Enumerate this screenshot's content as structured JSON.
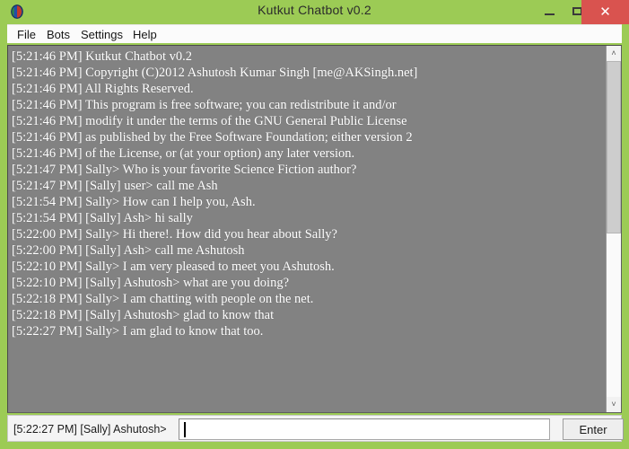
{
  "window": {
    "title": "Kutkut Chatbot v0.2",
    "icon": "globe-icon",
    "titlebar_color": "#9ccb55",
    "close_button_color": "#d9534f",
    "controls": {
      "minimize_label": "–",
      "maximize_label": "□",
      "close_label": "✕"
    }
  },
  "menubar": {
    "items": [
      {
        "label": "File"
      },
      {
        "label": "Bots"
      },
      {
        "label": "Settings"
      },
      {
        "label": "Help"
      }
    ]
  },
  "chatlog": {
    "background_color": "#828282",
    "text_color": "#ffffff",
    "lines": [
      "[5:21:46 PM] Kutkut Chatbot v0.2",
      "[5:21:46 PM] Copyright (C)2012 Ashutosh Kumar Singh [me@AKSingh.net]",
      "[5:21:46 PM] All Rights Reserved.",
      "[5:21:46 PM] This program is free software; you can redistribute it and/or",
      "[5:21:46 PM] modify it under the terms of the GNU General Public License",
      "[5:21:46 PM] as published by the Free Software Foundation; either version 2",
      "[5:21:46 PM] of the License, or (at your option) any later version.",
      "[5:21:47 PM] Sally> Who is your favorite Science Fiction author?",
      "[5:21:47 PM] [Sally] user> call me Ash",
      "[5:21:54 PM] Sally> How can I help you, Ash.",
      "[5:21:54 PM] [Sally] Ash> hi sally",
      "[5:22:00 PM] Sally> Hi there!. How did you hear about Sally?",
      "[5:22:00 PM] [Sally] Ash> call me Ashutosh",
      "[5:22:10 PM] Sally> I am very pleased to meet you Ashutosh.",
      "[5:22:10 PM] [Sally] Ashutosh> what are you doing?",
      "[5:22:18 PM] Sally> I am chatting with people on the net.",
      "[5:22:18 PM] [Sally] Ashutosh> glad to know that",
      "[5:22:27 PM] Sally> I am glad to know that too."
    ]
  },
  "scrollbar": {
    "up_arrow": "˄",
    "down_arrow": "˅"
  },
  "input_row": {
    "prompt": "[5:22:27 PM] [Sally] Ashutosh>",
    "value": "",
    "placeholder": "",
    "enter_label": "Enter"
  }
}
